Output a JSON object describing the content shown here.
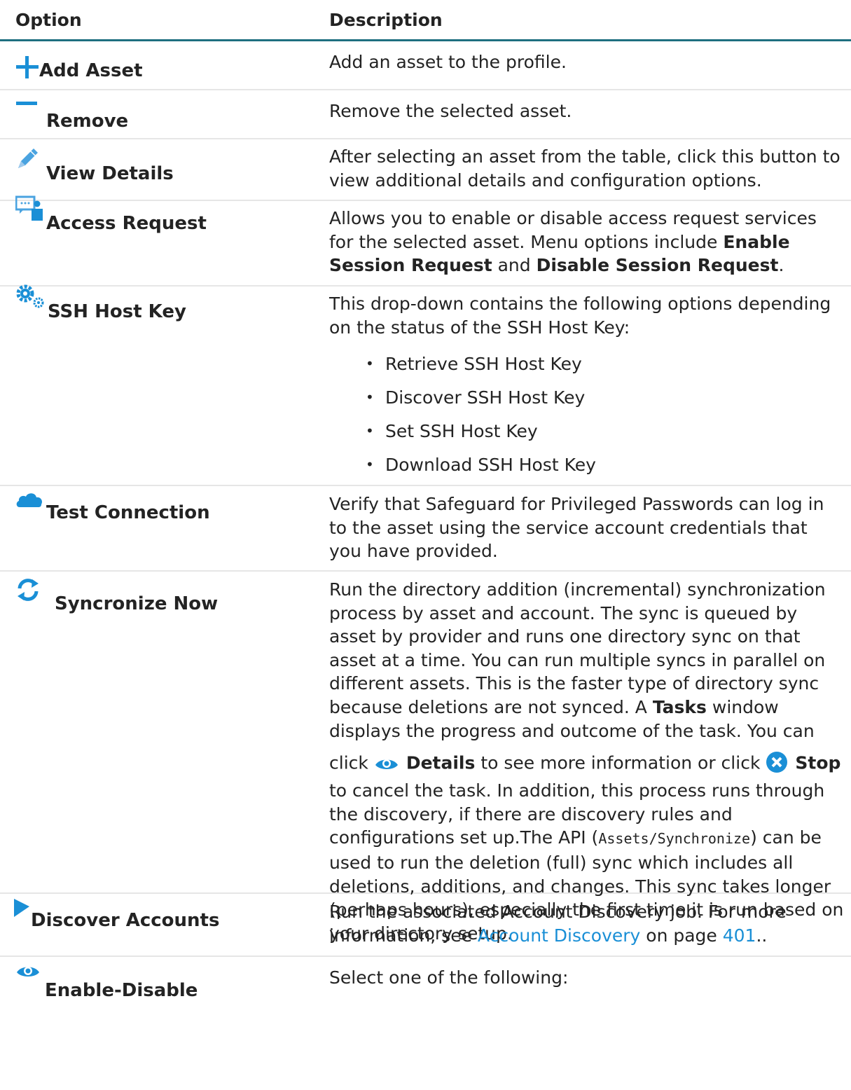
{
  "header": {
    "option": "Option",
    "description": "Description"
  },
  "rows": [
    {
      "label": "Add Asset",
      "icon": "plus-icon",
      "desc": "Add an asset to the profile."
    },
    {
      "label": "Remove",
      "icon": "minus-icon",
      "desc": "Remove the selected asset."
    },
    {
      "label": "View Details",
      "icon": "pencil-icon",
      "desc": "After selecting an asset from the table, click this button to view additional details and configuration options."
    },
    {
      "label": "Access Request",
      "icon": "access-request-icon",
      "desc_1": "Allows you to enable or disable access request services for the selected asset. Menu options include ",
      "bold_1": "Enable Session Request",
      "desc_2": " and ",
      "bold_2": "Disable Session Request",
      "desc_3": "."
    },
    {
      "label": "SSH Host Key",
      "icon": "gears-icon",
      "desc": "This drop-down contains the following options depending on the status of the SSH Host Key:",
      "bullets": [
        "Retrieve SSH Host Key",
        "Discover SSH Host Key",
        "Set SSH Host Key",
        "Download SSH Host Key"
      ]
    },
    {
      "label": "Test Connection",
      "icon": "cloud-icon",
      "desc": "Verify that Safeguard for Privileged Passwords can log in to the asset using the service account credentials that you have provided."
    },
    {
      "label": "Syncronize Now",
      "icon": "sync-icon",
      "desc_1": "Run the directory addition (incremental) synchronization process by asset and account. The sync is queued by asset by provider and runs one directory sync on that asset at a time. You can run multiple syncs in parallel on different assets. This is the faster type of directory sync because deletions are not synced. A ",
      "bold_tasks": "Tasks",
      "desc_2": " window displays the progress and outcome of the task. You can click ",
      "bold_details": "Details",
      "desc_3": " to see more information or click ",
      "bold_stop": "Stop",
      "desc_4": " to cancel the task. In addition, this process runs through the discovery, if there are discovery rules and configurations set up.The API (",
      "code": "Assets/Synchronize",
      "desc_5": ") can be used to run the deletion (full) sync which includes all deletions, additions, and changes. This sync takes longer (perhaps hours), especially the first time it is run based on your directory setup."
    },
    {
      "label": "Discover Accounts",
      "icon": "play-icon",
      "desc_1": "Run the associated Account Discovery job. For more information, see ",
      "link": "Account Discovery",
      "desc_2": " on page ",
      "page": "401",
      "desc_3": ".."
    },
    {
      "label": "Enable-Disable",
      "icon": "eye-icon",
      "desc": "Select one of the following:"
    }
  ],
  "colors": {
    "accent": "#1a8fd6",
    "header_rule": "#1e6f80",
    "row_rule": "#e6e6e6"
  }
}
